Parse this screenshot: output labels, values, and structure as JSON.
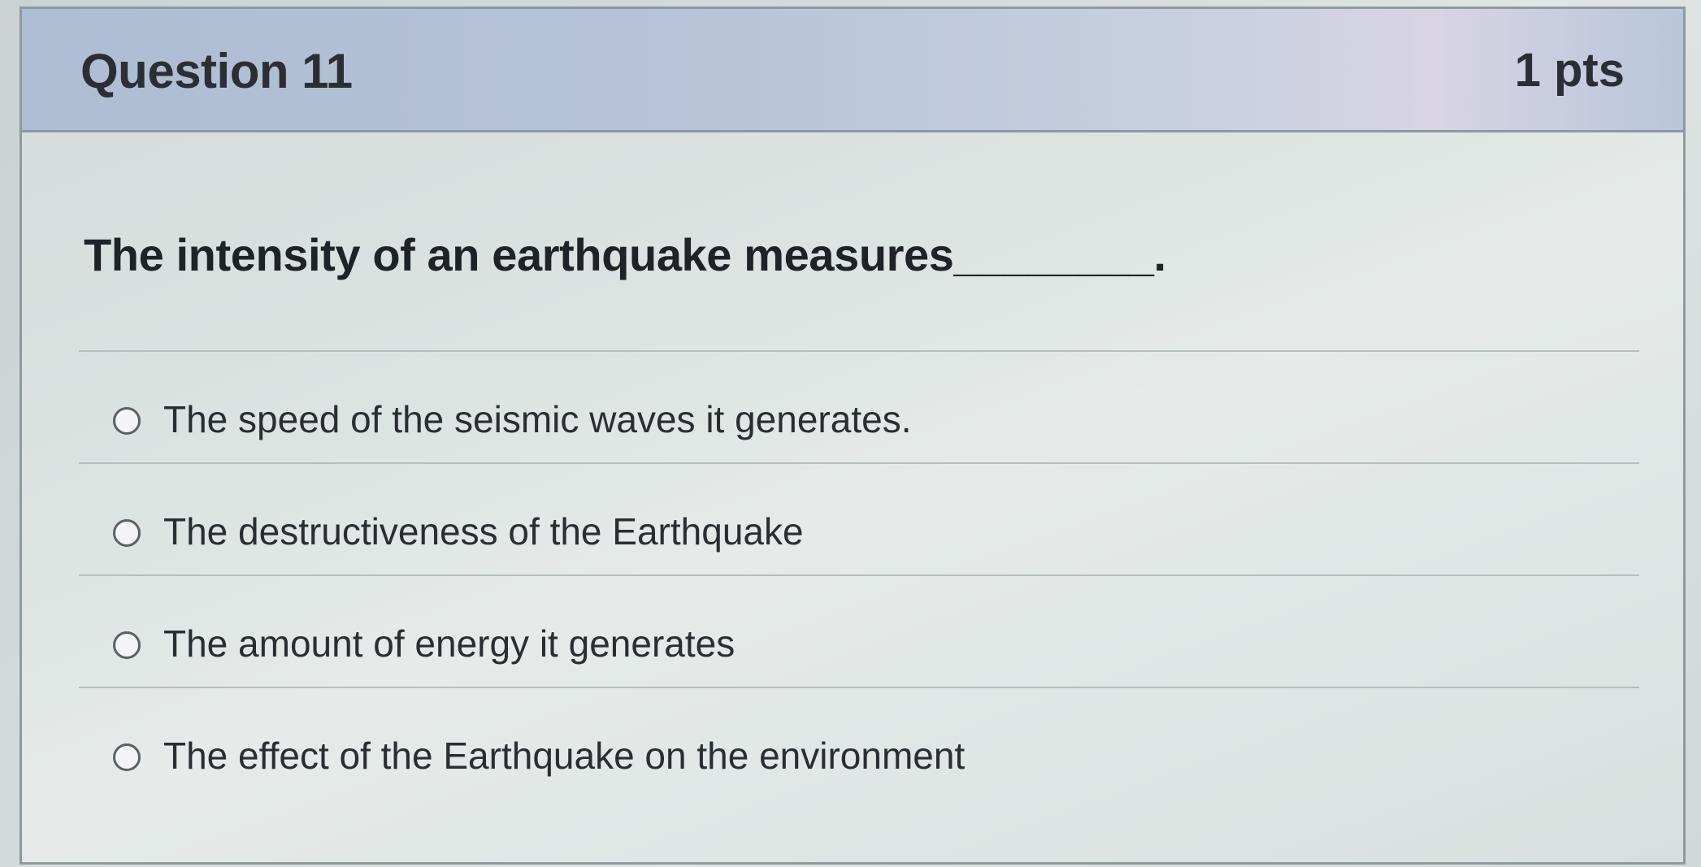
{
  "question": {
    "title": "Question 11",
    "points": "1 pts",
    "text": "The intensity of an earthquake measures________."
  },
  "answers": [
    {
      "label": "The speed of the seismic waves it generates."
    },
    {
      "label": "The destructiveness of the Earthquake"
    },
    {
      "label": "The amount of energy it generates"
    },
    {
      "label": "The effect of the Earthquake on the environment"
    }
  ]
}
